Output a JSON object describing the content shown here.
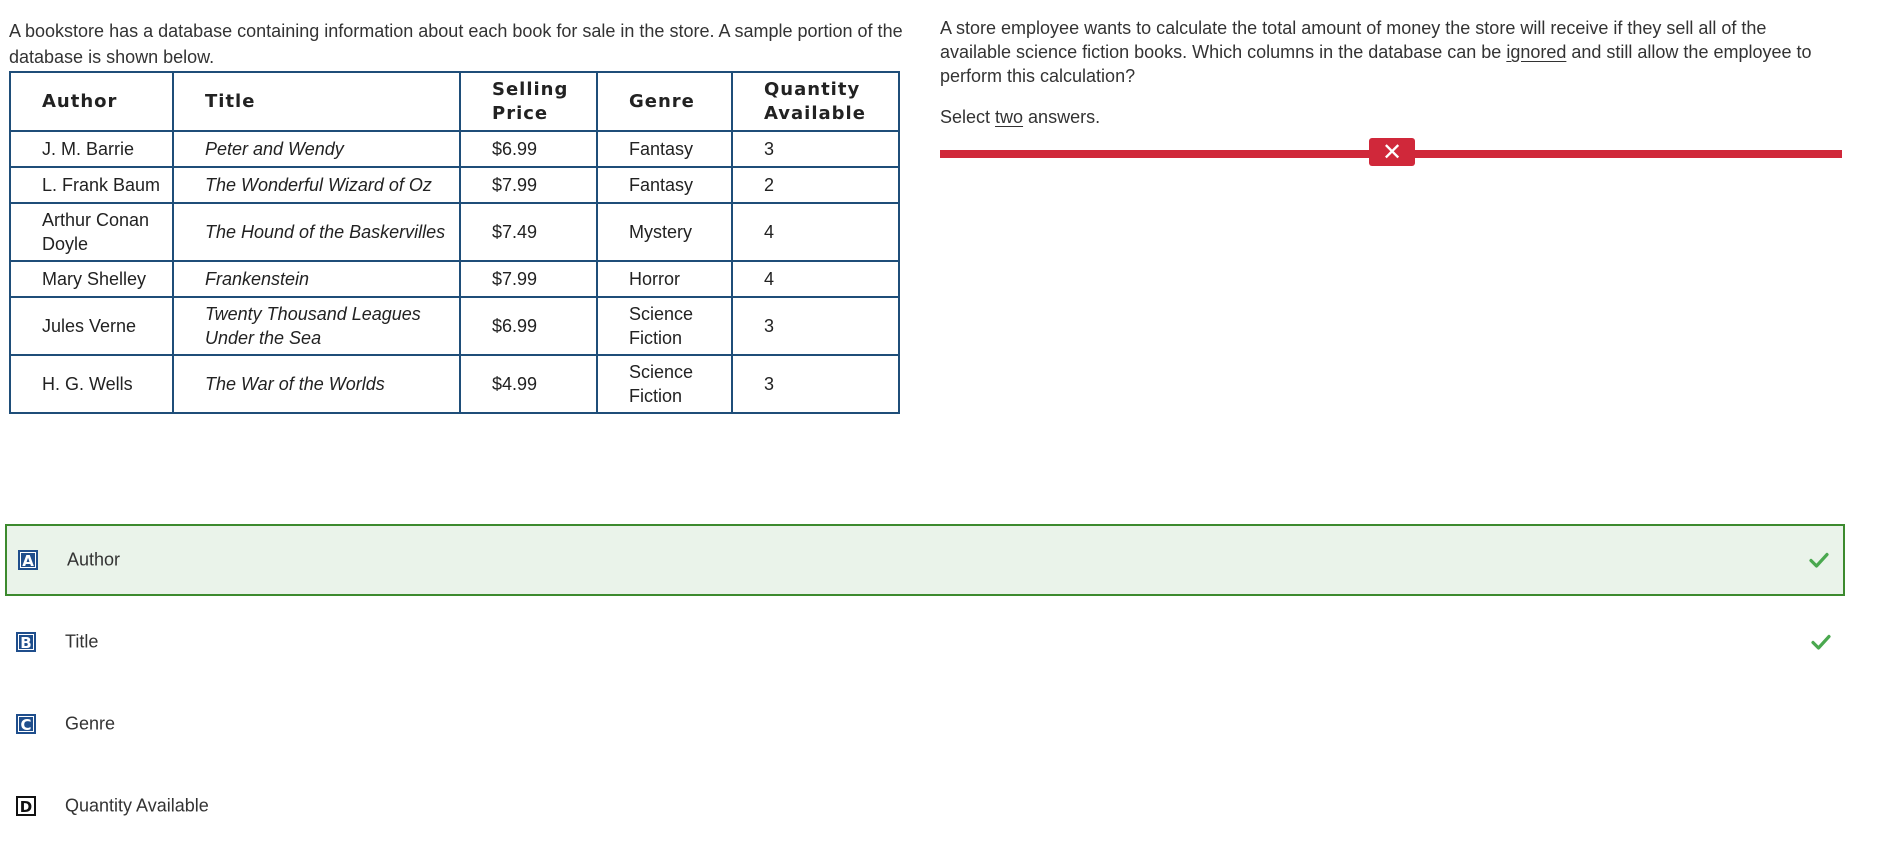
{
  "stimulus": {
    "intro": "A bookstore has a database containing information about each book for sale in the store. A sample portion of the database is shown below."
  },
  "table": {
    "headers": [
      "Author",
      "Title",
      "Selling Price",
      "Genre",
      "Quantity Available"
    ],
    "rows": [
      {
        "author": "J. M. Barrie",
        "title": "Peter and Wendy",
        "price": "$6.99",
        "genre": "Fantasy",
        "qty": "3"
      },
      {
        "author": "L. Frank Baum",
        "title": "The Wonderful Wizard of Oz",
        "price": "$7.99",
        "genre": "Fantasy",
        "qty": "2"
      },
      {
        "author": "Arthur Conan Doyle",
        "title": "The Hound of the Baskervilles",
        "price": "$7.49",
        "genre": "Mystery",
        "qty": "4"
      },
      {
        "author": "Mary Shelley",
        "title": "Frankenstein",
        "price": "$7.99",
        "genre": "Horror",
        "qty": "4"
      },
      {
        "author": "Jules Verne",
        "title": "Twenty Thousand Leagues Under the Sea",
        "price": "$6.99",
        "genre": "Science Fiction",
        "qty": "3"
      },
      {
        "author": "H. G. Wells",
        "title": "The War of the Worlds",
        "price": "$4.99",
        "genre": "Science Fiction",
        "qty": "3"
      }
    ]
  },
  "question": {
    "part1": "A store employee wants to calculate the total amount of money the store will receive if they sell all of the available science fiction books. Which columns in the database can be ",
    "emphasis": "ignored",
    "part2": " and still allow the employee to perform this calculation?",
    "instruction_pre": "Select ",
    "instruction_emphasis": "two",
    "instruction_post": " answers.",
    "result_icon": "x-icon",
    "result_color": "#d0283a"
  },
  "choices": [
    {
      "letter": "A",
      "label": "Author",
      "selected": true,
      "correct": true
    },
    {
      "letter": "B",
      "label": "Title",
      "selected": false,
      "correct": true
    },
    {
      "letter": "C",
      "label": "Genre",
      "selected": false,
      "correct": false
    },
    {
      "letter": "D",
      "label": "Quantity Available",
      "selected": false,
      "correct": false
    }
  ],
  "colors": {
    "table_border": "#1f4e79",
    "correct_check": "#4aa84f",
    "selected_bg": "#eaf3ea",
    "selected_border": "#3c8a2e",
    "letter_fill": "#1f4e8c"
  }
}
